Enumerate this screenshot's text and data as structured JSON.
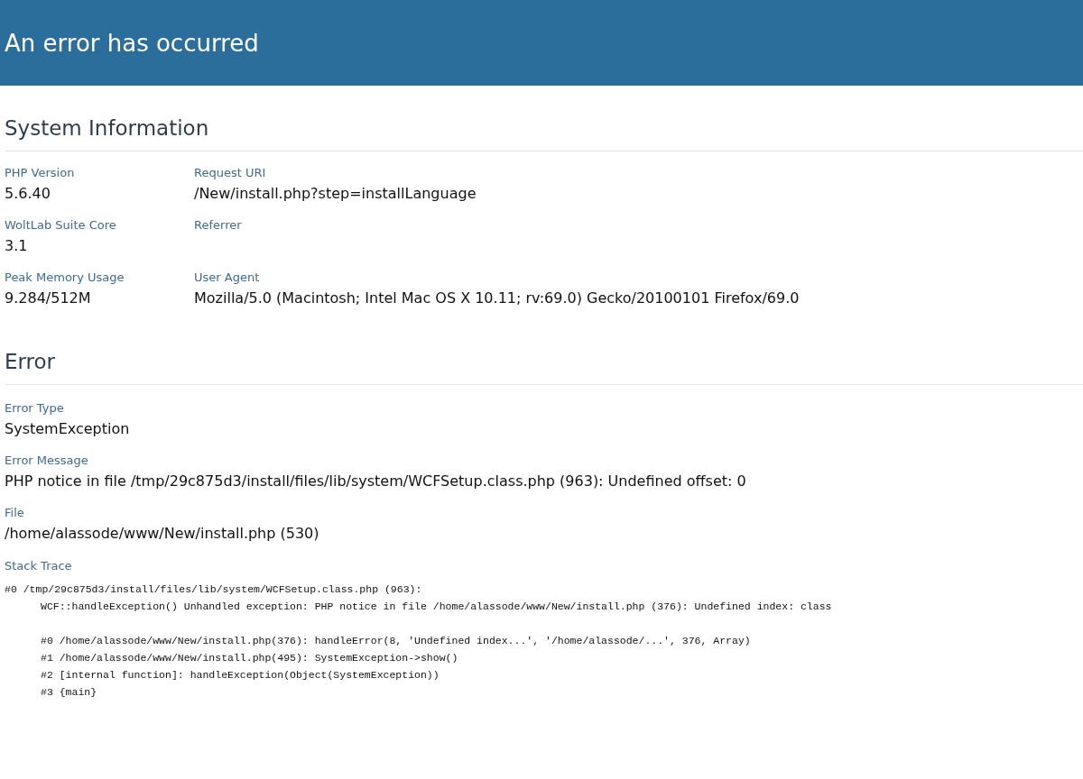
{
  "header": {
    "title": "An error has occurred"
  },
  "sections": [
    {
      "title": "System Information",
      "kind": "grid",
      "fields": [
        {
          "label": "PHP Version",
          "value": "5.6.40"
        },
        {
          "label": "Request URI",
          "value": "/New/install.php?step=installLanguage"
        },
        {
          "label": "WoltLab Suite Core",
          "value": "3.1"
        },
        {
          "label": "Referrer"
        },
        {
          "label": "Peak Memory Usage",
          "value": "9.284/512M"
        },
        {
          "label": "User Agent",
          "value": "Mozilla/5.0 (Macintosh; Intel Mac OS X 10.11; rv:69.0) Gecko/20100101 Firefox/69.0"
        }
      ]
    },
    {
      "title": "Error",
      "kind": "list",
      "fields": [
        {
          "label": "Error Type",
          "value": "SystemException"
        },
        {
          "label": "Error Message",
          "value": "PHP notice in file /tmp/29c875d3/install/files/lib/system/WCFSetup.class.php (963): Undefined offset: 0"
        },
        {
          "label": "File",
          "value": "/home/alassode/www/New/install.php (530)"
        }
      ],
      "stack_trace": {
        "label": "Stack Trace",
        "frame": "#0 /tmp/29c875d3/install/files/lib/system/WCFSetup.class.php (963):",
        "message": "WCF::handleException() Unhandled exception: PHP notice in file /home/alassode/www/New/install.php (376): Undefined index: class",
        "inner_frames": [
          "#0 /home/alassode/www/New/install.php(376): handleError(8, 'Undefined index...', '/home/alassode/...', 376, Array)",
          "#1 /home/alassode/www/New/install.php(495): SystemException->show()",
          "#2 [internal function]: handleException(Object(SystemException))",
          "#3 {main}"
        ]
      }
    }
  ]
}
